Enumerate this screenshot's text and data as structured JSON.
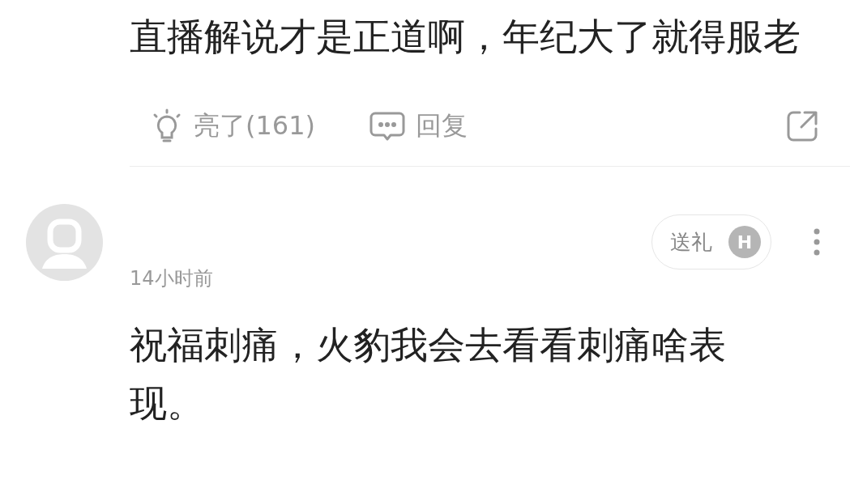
{
  "comments": [
    {
      "text": "直播解说才是正道啊，年纪大了就得服老",
      "like_label": "亮了(161)",
      "reply_label": "回复"
    },
    {
      "time": "14小时前",
      "gift_label": "送礼",
      "gift_badge": "H",
      "text": "祝福刺痛，火豹我会去看看刺痛啥表现。"
    }
  ]
}
